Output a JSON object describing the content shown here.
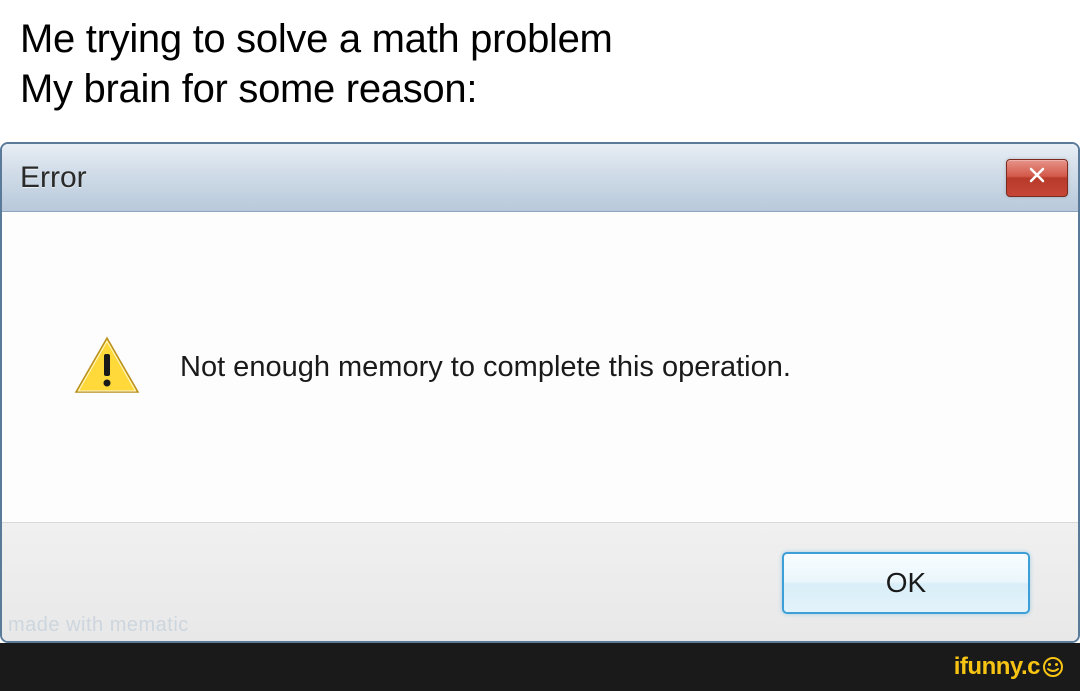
{
  "caption": {
    "line1": "Me trying to solve a math problem",
    "line2": "My brain for some reason:"
  },
  "dialog": {
    "title": "Error",
    "message": "Not enough memory to complete this operation.",
    "ok_label": "OK"
  },
  "watermarks": {
    "mematic": "made with mematic",
    "ifunny": "ifunny.c"
  }
}
